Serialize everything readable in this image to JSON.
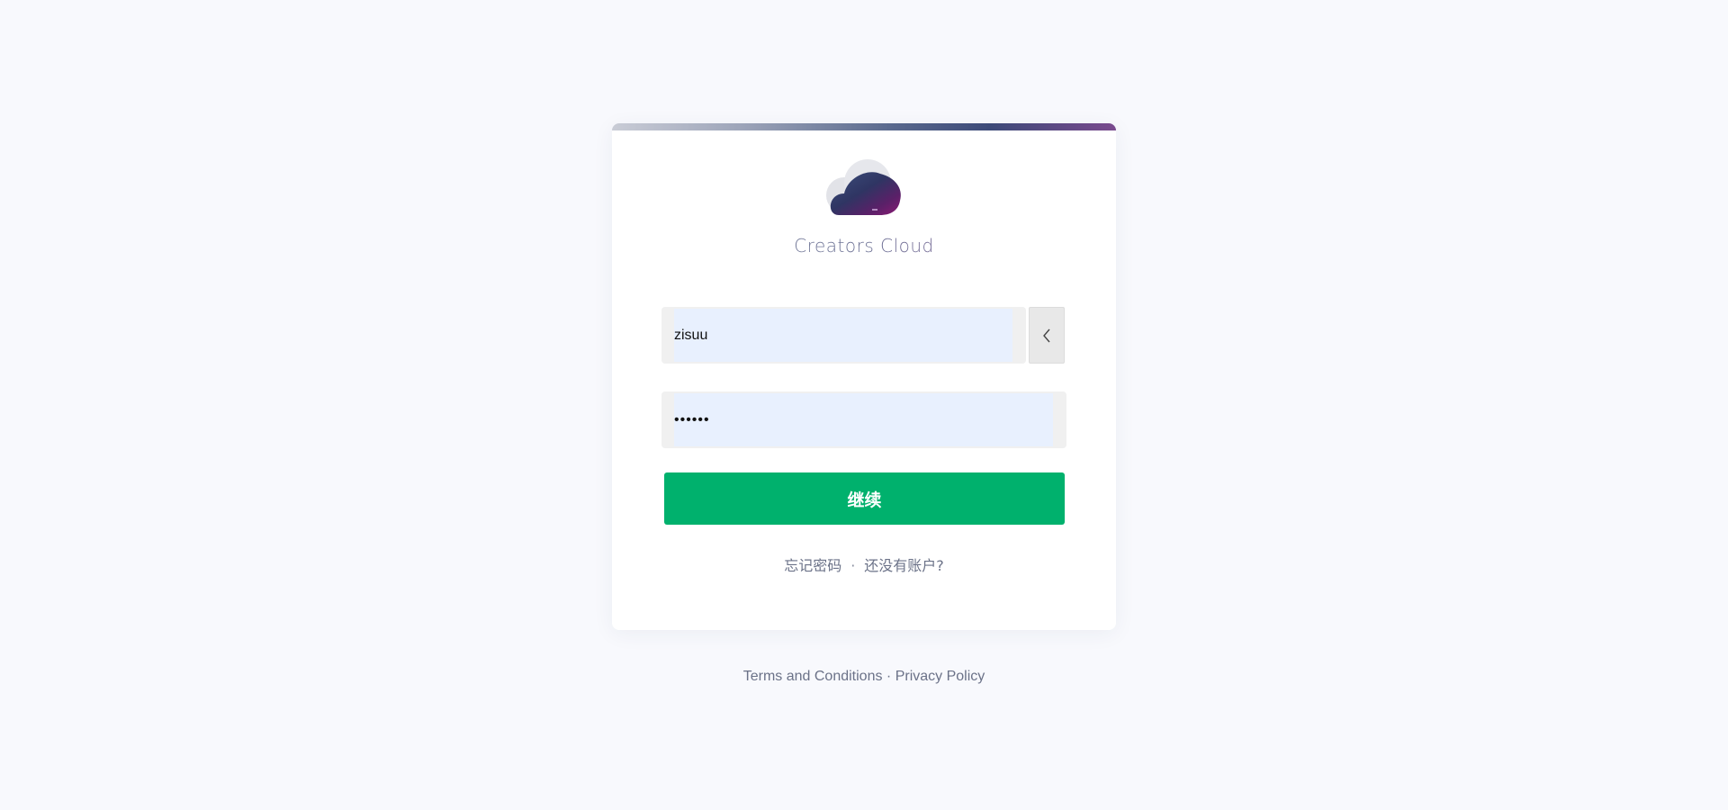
{
  "brand": {
    "name": "Creators Cloud",
    "logo_icon": "cloud-logo-icon"
  },
  "form": {
    "username": {
      "value": "zisuu",
      "placeholder": ""
    },
    "password": {
      "value": "zisuuu",
      "placeholder": ""
    },
    "back_icon": "chevron-left-icon",
    "submit_label": "继续"
  },
  "links": {
    "forgot_password": "忘记密码",
    "separator": "·",
    "no_account": "还没有账户?"
  },
  "footer": {
    "terms": "Terms and Conditions",
    "separator": " · ",
    "privacy": "Privacy Policy"
  },
  "colors": {
    "page_background": "#f8f9fd",
    "card_background": "#ffffff",
    "primary_button": "#00b16d",
    "input_autofill": "#e8f0fe",
    "link_text": "#6b7288"
  }
}
